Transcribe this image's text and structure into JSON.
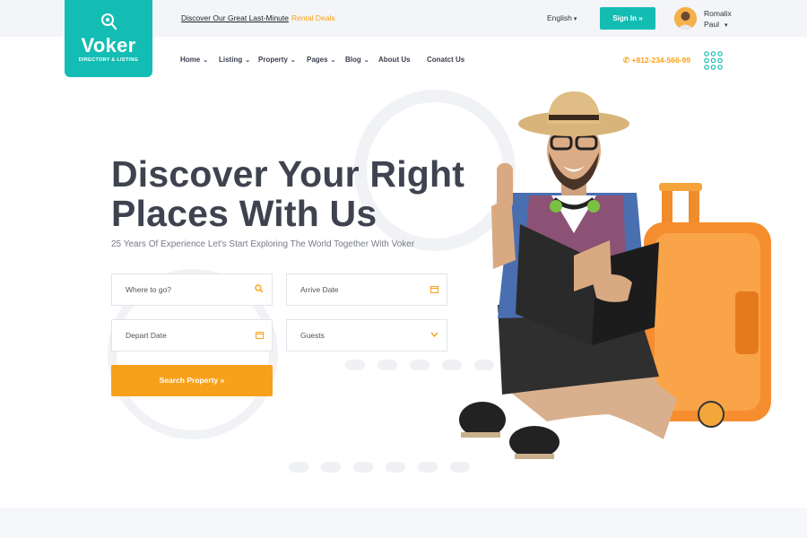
{
  "topbar": {
    "promo_text": "Discover Our Great Last-Minute",
    "promo_highlight": "Rental Deals",
    "language": "English",
    "signin_label": "Sign In »",
    "user_first": "Romalix",
    "user_last": "Paul"
  },
  "logo": {
    "name": "Voker",
    "tagline": "DIRECTORY & LISTING"
  },
  "nav": {
    "items": [
      "Home",
      "Listing",
      "Property",
      "Pages",
      "Blog",
      "About Us",
      "Conatct Us"
    ],
    "phone": "+812-234-566-99"
  },
  "hero": {
    "title_line1": "Discover Your Right",
    "title_line2": "Places With Us",
    "subtitle": "25 Years Of Experience Let's Start Exploring The World Together With Voker"
  },
  "search": {
    "where_placeholder": "Where to go?",
    "arrive_placeholder": "Arrive Date",
    "depart_placeholder": "Depart Date",
    "guests_label": "Guests",
    "button_label": "Search Property »"
  },
  "colors": {
    "primary": "#14bdb4",
    "accent": "#f7a11a",
    "heading": "#3f4350"
  },
  "icons": {
    "logo": "map-pin-search-icon",
    "phone": "phone-icon",
    "menu": "dot-grid-icon",
    "search": "search-icon",
    "calendar": "calendar-icon",
    "dropdown": "chevron-down-icon"
  }
}
